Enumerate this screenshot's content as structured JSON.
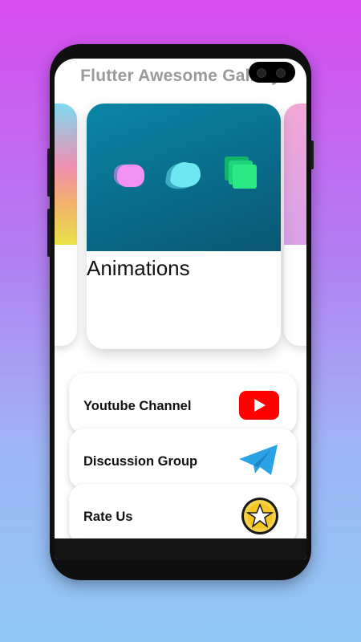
{
  "app": {
    "title": "Flutter Awesome Gallery"
  },
  "carousel": {
    "active_card": {
      "title": "Animations",
      "icon": "animation-shapes-icon"
    }
  },
  "menu": {
    "items": [
      {
        "label": "Youtube Channel",
        "icon": "youtube-icon",
        "color": "#ff0000"
      },
      {
        "label": "Discussion Group",
        "icon": "telegram-icon",
        "color": "#2aa3e6"
      },
      {
        "label": "Rate Us",
        "icon": "star-badge-icon",
        "color": "#f3c623"
      },
      {
        "label": "",
        "icon": "partial-icon"
      }
    ]
  }
}
